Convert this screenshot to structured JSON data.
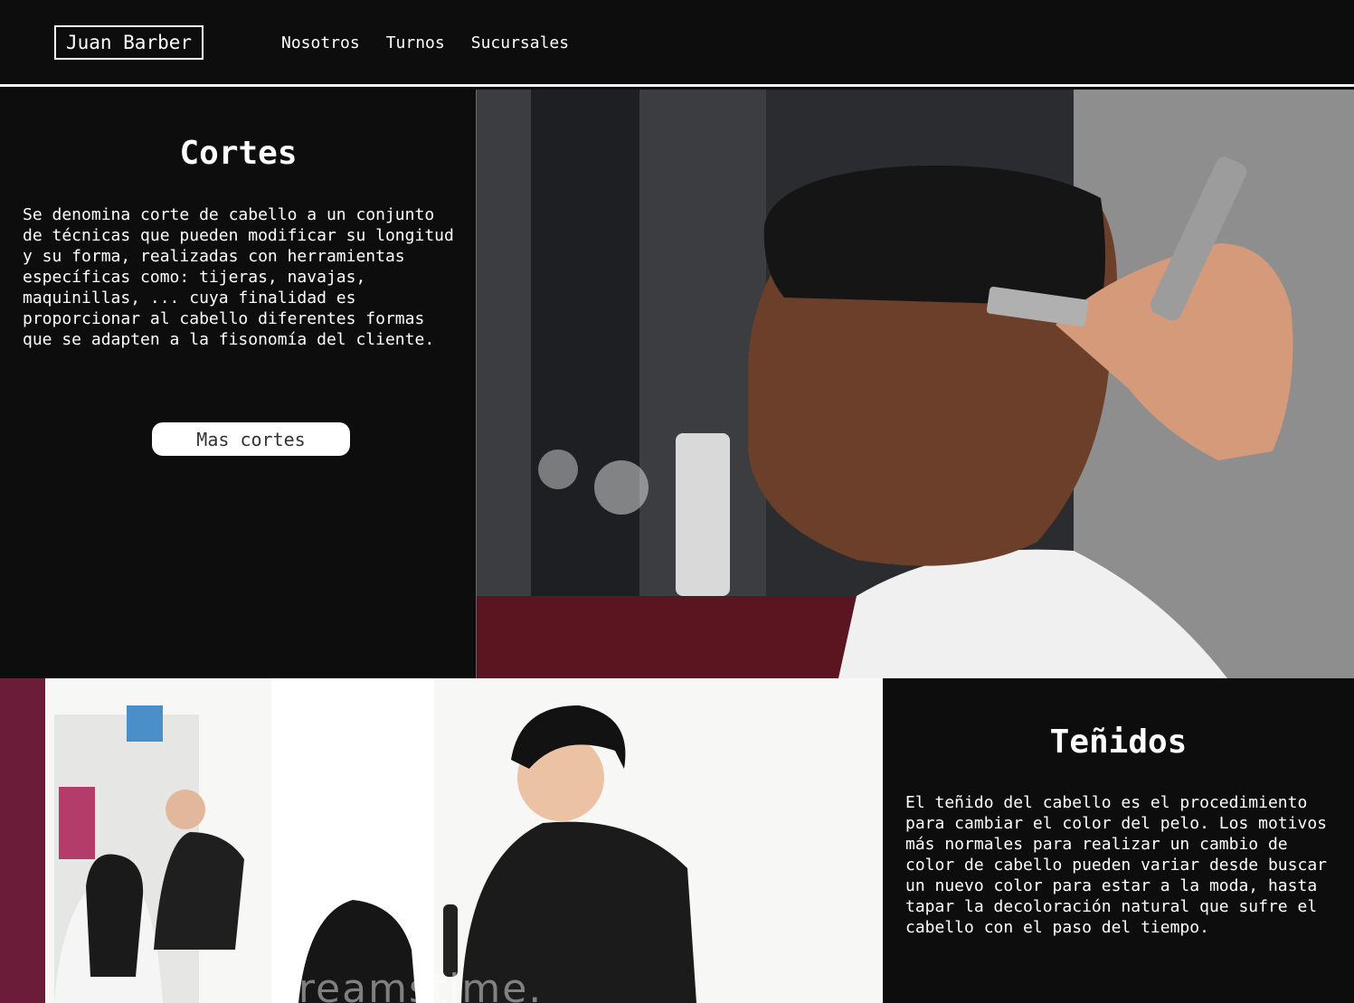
{
  "nav": {
    "brand": "Juan Barber",
    "links": [
      "Nosotros",
      "Turnos",
      "Sucursales"
    ]
  },
  "cortes": {
    "title": "Cortes",
    "text": "Se denomina corte de cabello a un conjunto de técnicas que pueden modificar su longitud y su forma, realizadas con herramientas específicas como: tijeras, navajas, maquinillas, ... cuya finalidad es proporcionar al cabello diferentes formas que se adapten a la fisonomía del cliente.",
    "button": "Mas cortes"
  },
  "tenidos": {
    "title": "Teñidos",
    "text": "El teñido del cabello es el procedimiento para cambiar el color del pelo. Los motivos más normales para realizar un cambio de color de cabello pueden variar desde buscar un nuevo color para estar a la moda, hasta tapar la decoloración natural que sufre el cabello con el paso del tiempo."
  },
  "images": {
    "watermark": "dreamstime."
  },
  "colors": {
    "background": "#0d0d0d",
    "text": "#ffffff",
    "button_bg": "#ffffff",
    "button_text": "#333333"
  }
}
